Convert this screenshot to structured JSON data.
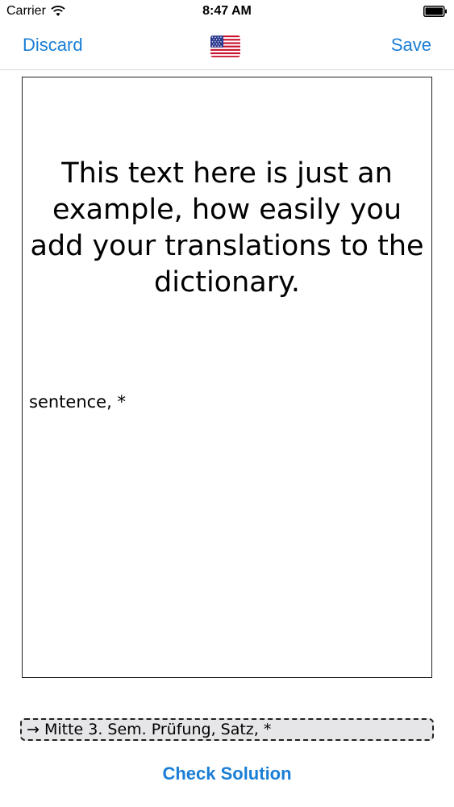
{
  "status_bar": {
    "carrier": "Carrier",
    "time": "8:47 AM",
    "wifi_icon": "wifi-icon",
    "battery_icon": "battery-icon"
  },
  "nav": {
    "discard_label": "Discard",
    "save_label": "Save",
    "flag_icon": "us-flag-icon"
  },
  "card": {
    "text": "This text here is just an example, how easily you add your translations to the dictionary.",
    "tags": "sentence, *"
  },
  "answer": {
    "value": "→ Mitte 3. Sem. Prüfung, Satz, *"
  },
  "actions": {
    "check_label": "Check Solution"
  },
  "colors": {
    "accent": "#1a7ed6",
    "field_background": "#e6e6e8"
  }
}
